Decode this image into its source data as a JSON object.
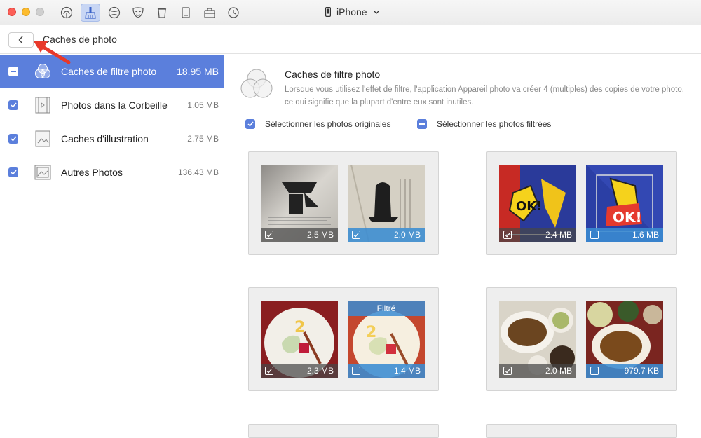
{
  "device": {
    "name": "iPhone"
  },
  "header": {
    "title": "Caches de photo"
  },
  "sidebar": {
    "items": [
      {
        "label": "Caches de filtre photo",
        "size": "18.95 MB"
      },
      {
        "label": "Photos dans la Corbeille",
        "size": "1.05 MB"
      },
      {
        "label": "Caches d'illustration",
        "size": "2.75 MB"
      },
      {
        "label": "Autres Photos",
        "size": "136.43 MB"
      }
    ]
  },
  "content": {
    "title": "Caches de filtre photo",
    "description": "Lorsque vous utilisez l'effet de filtre, l'application Appareil photo va créer 4 (multiples) des copies de votre photo, ce qui signifie que la plupart d'entre eux sont inutiles.",
    "select_originals": "Sélectionner les photos originales",
    "select_filtered": "Sélectionner les photos filtrées"
  },
  "groups": [
    {
      "original_size": "2.5 MB",
      "filtered_size": "2.0 MB"
    },
    {
      "original_size": "2.4 MB",
      "filtered_size": "1.6 MB"
    },
    {
      "original_size": "2.3 MB",
      "filtered_size": "1.4 MB",
      "filtered_label": "Filtré"
    },
    {
      "original_size": "2.0 MB",
      "filtered_size": "979.7 KB"
    }
  ],
  "colors": {
    "accent": "#5b7fdc",
    "filtered_bar": "#3a8cd2",
    "annotation_arrow": "#e8392a"
  }
}
